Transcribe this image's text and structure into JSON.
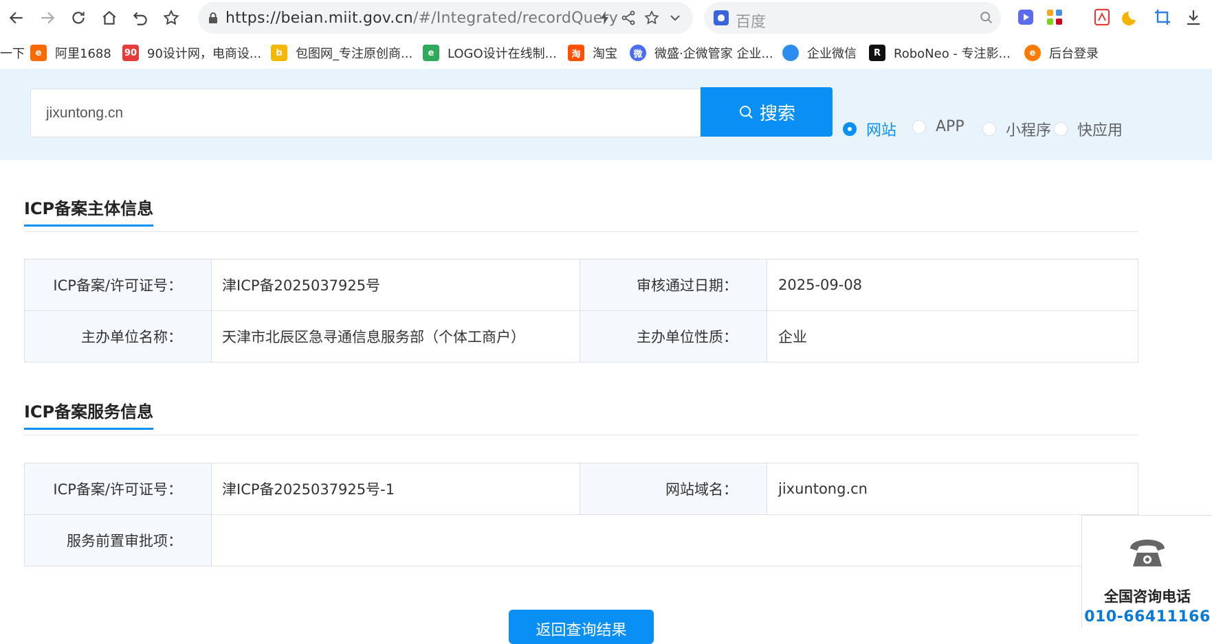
{
  "browser": {
    "url_domain": "https://beian.miit.gov.cn",
    "url_path": "/#/Integrated/recordQuery",
    "search_engine": "百度"
  },
  "bookmarks": [
    {
      "label": "一下",
      "icon": "bookmark-icon"
    },
    {
      "label": "阿里1688",
      "icon": "alibaba-icon",
      "badge": "e",
      "color": "#ff6a00"
    },
    {
      "label": "90设计网，电商设...",
      "icon": "90-icon",
      "badge": "90",
      "color": "#e63b3b"
    },
    {
      "label": "包图网_专注原创商...",
      "icon": "baotu-icon",
      "badge": "b",
      "color": "#f5b800"
    },
    {
      "label": "LOGO设计在线制...",
      "icon": "logo-design-icon",
      "badge": "e",
      "color": "#2eaa5b"
    },
    {
      "label": "淘宝",
      "icon": "taobao-icon",
      "badge": "淘",
      "color": "#ff5000"
    },
    {
      "label": "微盛·企微管家 企业...",
      "icon": "weisheng-icon",
      "badge": "微",
      "color": "#4a6cf7"
    },
    {
      "label": "企业微信",
      "icon": "wecom-icon",
      "badge": "",
      "color": "#2d8cf0"
    },
    {
      "label": "RoboNeo - 专注影...",
      "icon": "roboneo-icon",
      "badge": "R",
      "color": "#111111"
    },
    {
      "label": "后台登录",
      "icon": "edge-icon",
      "badge": "e",
      "color": "#ff7a00"
    }
  ],
  "search": {
    "query": "jixuntong.cn",
    "button_label": "搜索",
    "types": [
      {
        "label": "网站",
        "checked": true
      },
      {
        "label": "APP",
        "checked": false
      },
      {
        "label": "小程序",
        "checked": false
      },
      {
        "label": "快应用",
        "checked": false
      }
    ]
  },
  "subject_section": {
    "title": "ICP备案主体信息",
    "rows": [
      {
        "label1": "ICP备案/许可证号：",
        "value1": "津ICP备2025037925号",
        "label2": "审核通过日期：",
        "value2": "2025-09-08"
      },
      {
        "label1": "主办单位名称：",
        "value1": "天津市北辰区急寻通信息服务部（个体工商户）",
        "label2": "主办单位性质：",
        "value2": "企业"
      }
    ]
  },
  "service_section": {
    "title": "ICP备案服务信息",
    "row1": {
      "label1": "ICP备案/许可证号：",
      "value1": "津ICP备2025037925号-1",
      "label2": "网站域名：",
      "value2": "jixuntong.cn"
    },
    "row2": {
      "label1": "服务前置审批项：",
      "value1": ""
    }
  },
  "back_button_label": "返回查询结果",
  "hotline": {
    "label": "全国咨询电话",
    "number": "010-66411166"
  },
  "colors": {
    "accent": "#0a8ff4",
    "strip": "#e8f3fc",
    "label_bg": "#f5f9fd"
  }
}
